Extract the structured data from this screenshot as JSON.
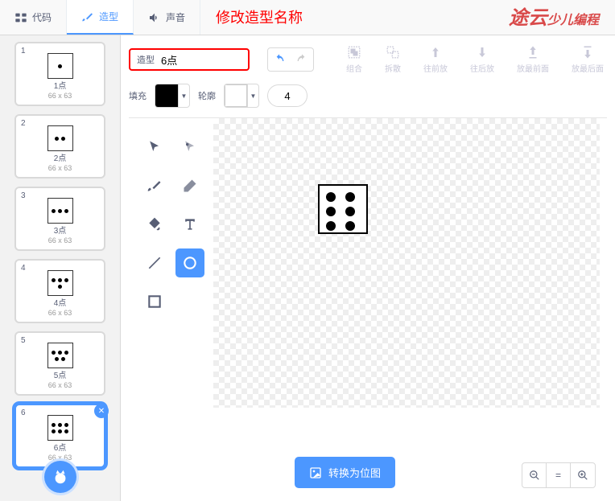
{
  "tabs": {
    "code": "代码",
    "costumes": "造型",
    "sounds": "声音"
  },
  "annotation": "修改造型名称",
  "logo": {
    "main": "途云",
    "sub": "少儿编程"
  },
  "costumes": [
    {
      "num": "1",
      "name": "1点",
      "size": "66 x 63",
      "dots": 1
    },
    {
      "num": "2",
      "name": "2点",
      "size": "66 x 63",
      "dots": 2
    },
    {
      "num": "3",
      "name": "3点",
      "size": "66 x 63",
      "dots": 3
    },
    {
      "num": "4",
      "name": "4点",
      "size": "66 x 63",
      "dots": 4
    },
    {
      "num": "5",
      "name": "5点",
      "size": "66 x 63",
      "dots": 5
    },
    {
      "num": "6",
      "name": "6点",
      "size": "66 x 63",
      "dots": 6
    }
  ],
  "selected_costume": 5,
  "name_field": {
    "label": "造型",
    "value": "6点"
  },
  "tool_buttons": {
    "group": "组合",
    "ungroup": "拆散",
    "forward": "往前放",
    "backward": "往后放",
    "front": "放最前面",
    "back": "放最后面"
  },
  "fill": {
    "label": "填充",
    "color": "#000000"
  },
  "outline": {
    "label": "轮廓",
    "color": "#ffffff",
    "width": "4"
  },
  "convert": "转换为位图"
}
